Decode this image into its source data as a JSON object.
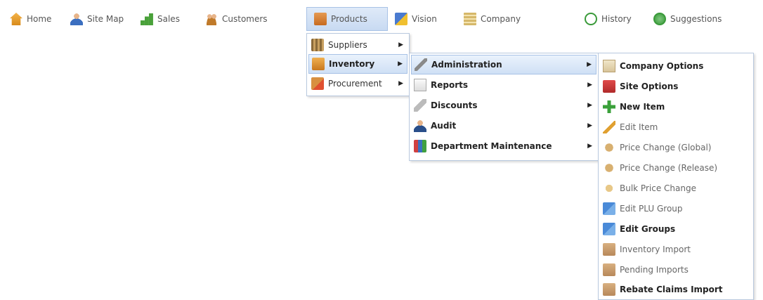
{
  "topnav": [
    {
      "label": "Home",
      "icon": "home-icon"
    },
    {
      "label": "Site Map",
      "icon": "sitemap-icon"
    },
    {
      "label": "Sales",
      "icon": "sales-chart-icon"
    },
    {
      "label": "Customers",
      "icon": "customers-icon"
    },
    {
      "label": "Products",
      "icon": "products-box-icon"
    },
    {
      "label": "Vision",
      "icon": "vision-icon"
    },
    {
      "label": "Company",
      "icon": "company-building-icon"
    },
    {
      "label": "History",
      "icon": "history-icon"
    },
    {
      "label": "Suggestions",
      "icon": "suggestions-icon"
    }
  ],
  "products_menu": [
    {
      "label": "Suppliers",
      "icon": "suppliers-icon",
      "has_submenu": true
    },
    {
      "label": "Inventory",
      "icon": "inventory-icon",
      "has_submenu": true,
      "highlighted": true
    },
    {
      "label": "Procurement",
      "icon": "procurement-icon",
      "has_submenu": true
    }
  ],
  "inventory_menu": [
    {
      "label": "Administration",
      "icon": "wrench-icon",
      "has_submenu": true,
      "highlighted": true
    },
    {
      "label": "Reports",
      "icon": "report-icon",
      "has_submenu": true
    },
    {
      "label": "Discounts",
      "icon": "discount-icon",
      "has_submenu": true
    },
    {
      "label": "Audit",
      "icon": "audit-icon",
      "has_submenu": true
    },
    {
      "label": "Department Maintenance",
      "icon": "department-icon",
      "has_submenu": true
    }
  ],
  "administration_menu": [
    {
      "label": "Company Options",
      "icon": "company-options-icon",
      "bold": true
    },
    {
      "label": "Site Options",
      "icon": "site-options-icon",
      "bold": true
    },
    {
      "label": "New Item",
      "icon": "new-item-icon",
      "bold": true
    },
    {
      "label": "Edit Item",
      "icon": "edit-item-icon",
      "bold": false
    },
    {
      "label": "Price Change (Global)",
      "icon": "price-change-icon",
      "bold": false
    },
    {
      "label": "Price Change (Release)",
      "icon": "price-change-icon",
      "bold": false
    },
    {
      "label": "Bulk Price Change",
      "icon": "bulk-price-icon",
      "bold": false
    },
    {
      "label": "Edit PLU Group",
      "icon": "plu-group-icon",
      "bold": false
    },
    {
      "label": "Edit Groups",
      "icon": "groups-icon",
      "bold": true
    },
    {
      "label": "Inventory Import",
      "icon": "import-icon",
      "bold": false
    },
    {
      "label": "Pending Imports",
      "icon": "import-icon",
      "bold": false
    },
    {
      "label": "Rebate Claims Import",
      "icon": "import-icon",
      "bold": true
    }
  ]
}
